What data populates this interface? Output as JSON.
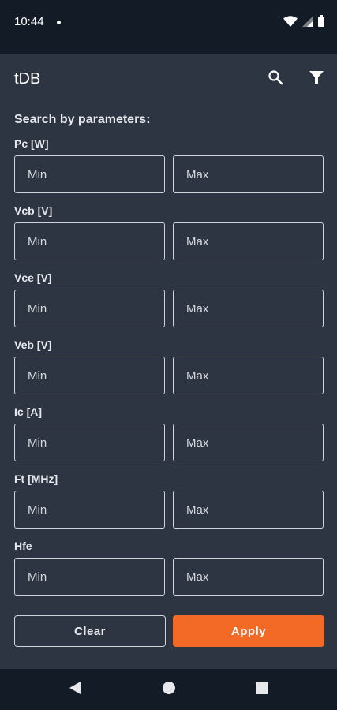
{
  "status_bar": {
    "time": "10:44",
    "icons": [
      "notification-dot-icon",
      "wifi-icon",
      "signal-icon",
      "battery-icon"
    ]
  },
  "app_bar": {
    "title": "tDB",
    "actions": [
      "search-icon",
      "filter-icon"
    ]
  },
  "form": {
    "heading": "Search by parameters:",
    "params": [
      {
        "label": "Pc [W]",
        "min": {
          "value": "",
          "placeholder": "Min"
        },
        "max": {
          "value": "",
          "placeholder": "Max"
        }
      },
      {
        "label": "Vcb [V]",
        "min": {
          "value": "",
          "placeholder": "Min"
        },
        "max": {
          "value": "",
          "placeholder": "Max"
        }
      },
      {
        "label": "Vce [V]",
        "min": {
          "value": "",
          "placeholder": "Min"
        },
        "max": {
          "value": "",
          "placeholder": "Max"
        }
      },
      {
        "label": "Veb [V]",
        "min": {
          "value": "",
          "placeholder": "Min"
        },
        "max": {
          "value": "",
          "placeholder": "Max"
        }
      },
      {
        "label": "Ic [A]",
        "min": {
          "value": "",
          "placeholder": "Min"
        },
        "max": {
          "value": "",
          "placeholder": "Max"
        }
      },
      {
        "label": "Ft [MHz]",
        "min": {
          "value": "",
          "placeholder": "Min"
        },
        "max": {
          "value": "",
          "placeholder": "Max"
        }
      },
      {
        "label": "Hfe",
        "min": {
          "value": "",
          "placeholder": "Min"
        },
        "max": {
          "value": "",
          "placeholder": "Max"
        }
      }
    ],
    "clear_label": "Clear",
    "apply_label": "Apply"
  },
  "nav_bar": {
    "buttons": [
      "back-icon",
      "home-icon",
      "recents-icon"
    ]
  },
  "colors": {
    "background": "#2d3542",
    "system_bars": "#131c26",
    "accent": "#f26a25",
    "outline": "#cfd3da"
  }
}
